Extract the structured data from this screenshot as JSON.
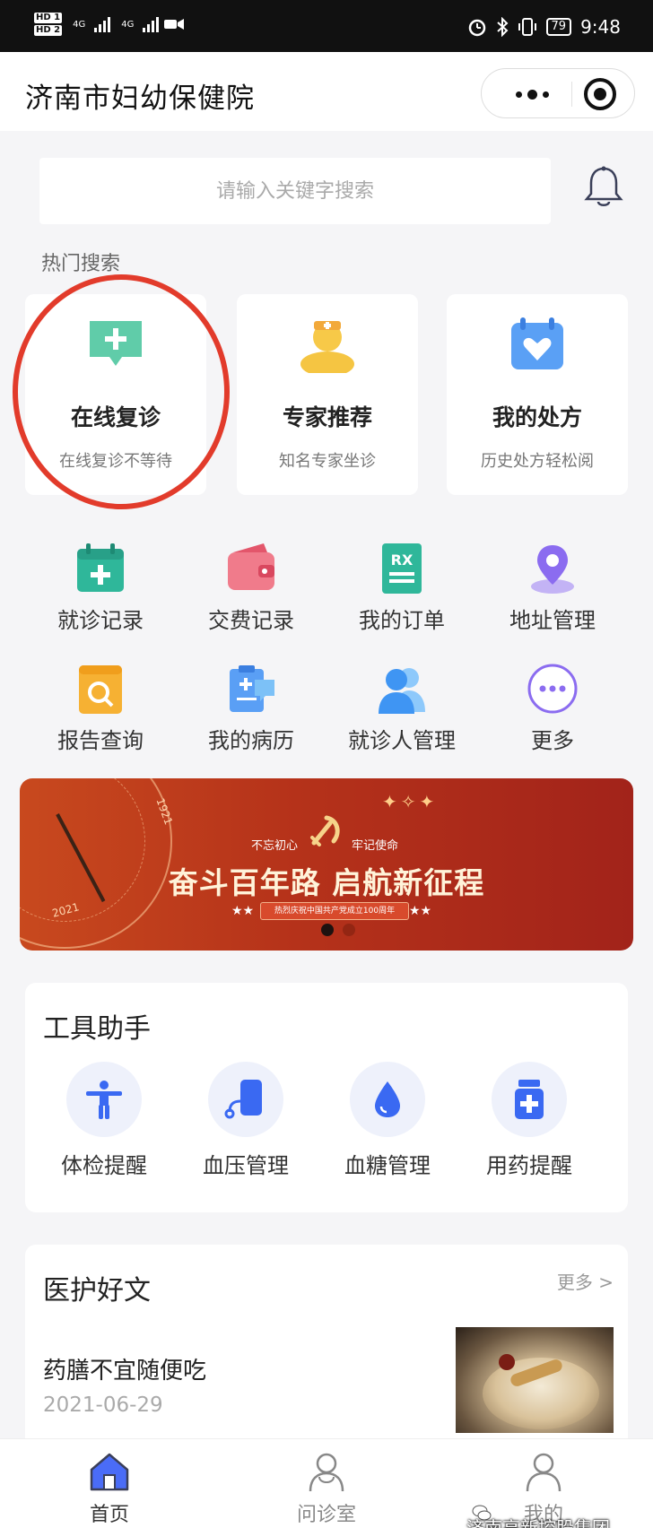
{
  "status_bar": {
    "hd1": "HD 1",
    "hd2": "HD 2",
    "net1": "4G",
    "net2": "4G",
    "battery": "79",
    "time": "9:48"
  },
  "header": {
    "title": "济南市妇幼保健院"
  },
  "search": {
    "placeholder": "请输入关键字搜索"
  },
  "hot_search": {
    "title": "热门搜索",
    "cards": [
      {
        "title": "在线复诊",
        "subtitle": "在线复诊不等待",
        "icon": "chat-plus-icon"
      },
      {
        "title": "专家推荐",
        "subtitle": "知名专家坐诊",
        "icon": "doctor-icon"
      },
      {
        "title": "我的处方",
        "subtitle": "历史处方轻松阅",
        "icon": "calendar-heart-icon"
      }
    ]
  },
  "shortcuts": [
    {
      "label": "就诊记录",
      "icon": "calendar-plus-icon"
    },
    {
      "label": "交费记录",
      "icon": "wallet-icon"
    },
    {
      "label": "我的订单",
      "icon": "rx-document-icon"
    },
    {
      "label": "地址管理",
      "icon": "location-pin-icon"
    },
    {
      "label": "报告查询",
      "icon": "report-search-icon"
    },
    {
      "label": "我的病历",
      "icon": "medical-record-icon"
    },
    {
      "label": "就诊人管理",
      "icon": "patients-icon"
    },
    {
      "label": "更多",
      "icon": "more-icon"
    }
  ],
  "banner": {
    "tag_left": "不忘初心",
    "tag_right": "牢记使命",
    "headline": "奋斗百年路 启航新征程",
    "ribbon": "热烈庆祝中国共产党成立100周年",
    "year_top": "1921",
    "year_bottom": "2021",
    "stars": "★★"
  },
  "tools": {
    "title": "工具助手",
    "items": [
      {
        "label": "体检提醒",
        "icon": "person-icon"
      },
      {
        "label": "血压管理",
        "icon": "blood-pressure-icon"
      },
      {
        "label": "血糖管理",
        "icon": "blood-drop-icon"
      },
      {
        "label": "用药提醒",
        "icon": "medicine-bottle-icon"
      }
    ]
  },
  "articles": {
    "title": "医护好文",
    "more": "更多 >",
    "items": [
      {
        "title": "药膳不宜随便吃",
        "date": "2021-06-29"
      }
    ]
  },
  "tab_bar": {
    "tabs": [
      {
        "label": "首页",
        "active": true
      },
      {
        "label": "问诊室",
        "active": false
      },
      {
        "label": "我的",
        "active": false
      }
    ]
  },
  "watermark": "济南高新控股集团",
  "colors": {
    "accent": "#4a6cf7",
    "highlight_ring": "#e23b2b",
    "background": "#f5f5f7"
  }
}
